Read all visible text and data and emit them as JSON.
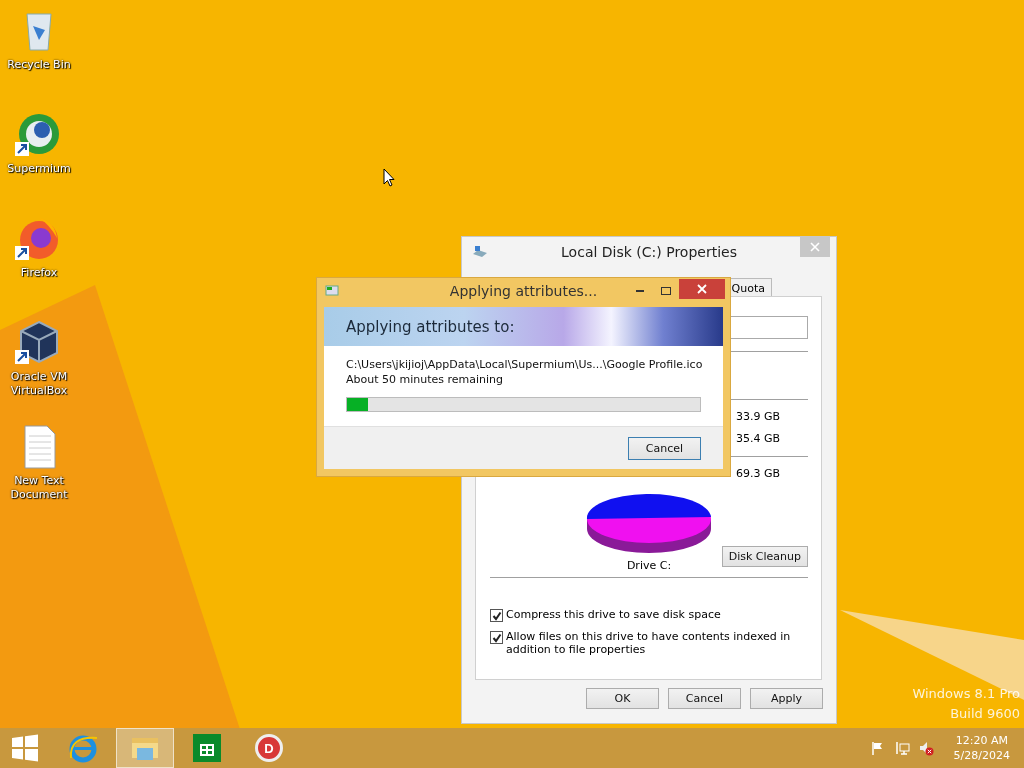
{
  "desktop_icons": [
    {
      "label": "Recycle Bin",
      "kind": "recycle",
      "shortcut": false
    },
    {
      "label": "Supermium",
      "kind": "browser",
      "shortcut": true
    },
    {
      "label": "Firefox",
      "kind": "firefox",
      "shortcut": true
    },
    {
      "label": "Oracle VM VirtualBox",
      "kind": "cube",
      "shortcut": true
    },
    {
      "label": "New Text Document",
      "kind": "textfile",
      "shortcut": false
    }
  ],
  "properties_window": {
    "title": "Local Disk (C:) Properties",
    "tabs": [
      {
        "label": "Quota",
        "selected": false
      }
    ],
    "sizes": [
      "33.9 GB",
      "35.4 GB",
      "69.3 GB"
    ],
    "drive_label": "Drive C:",
    "cleanup_button": "Disk Cleanup",
    "options": [
      {
        "label": "Compress this drive to save disk space",
        "checked": true
      },
      {
        "label": "Allow files on this drive to have contents indexed in addition to file properties",
        "checked": true
      }
    ],
    "buttons": [
      "OK",
      "Cancel",
      "Apply"
    ]
  },
  "progress_dialog": {
    "title": "Applying attributes...",
    "heading": "Applying attributes to:",
    "path": "C:\\Users\\jkijioj\\AppData\\Local\\Supermium\\Us...\\Google Profile.ico",
    "time_remaining": "About 50 minutes remaining",
    "level": 0.06,
    "button": "Cancel"
  },
  "os_edition": [
    "Windows 8.1 Pro",
    "Build 9600"
  ],
  "taskbar": {
    "apps": [
      {
        "kind": "ie",
        "selected": false
      },
      {
        "kind": "explorer",
        "selected": true
      },
      {
        "kind": "store",
        "selected": false
      },
      {
        "kind": "disc",
        "glyph": "D",
        "selected": false
      }
    ],
    "clock": {
      "time": "12:20 AM",
      "date": "5/28/2024"
    }
  }
}
